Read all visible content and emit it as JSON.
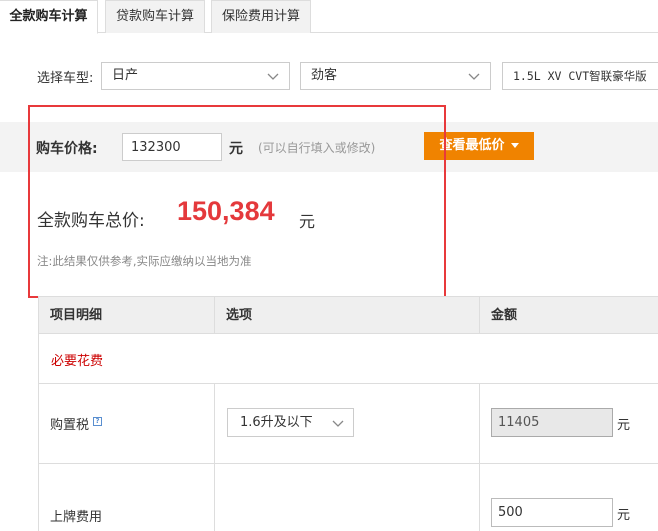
{
  "tabs": [
    {
      "label": "全款购车计算",
      "active": true
    },
    {
      "label": "贷款购车计算",
      "active": false
    },
    {
      "label": "保险费用计算",
      "active": false
    }
  ],
  "car_select": {
    "label": "选择车型:",
    "brand": "日产",
    "series": "劲客",
    "model": "1.5L XV CVT智联豪华版"
  },
  "price": {
    "label": "购车价格:",
    "value": "132300",
    "unit": "元",
    "hint": "(可以自行填入或修改)",
    "lowest_button": "查看最低价"
  },
  "total": {
    "label": "全款购车总价:",
    "value": "150,384",
    "unit": "元",
    "note": "注:此结果仅供参考,实际应缴纳以当地为准"
  },
  "table": {
    "headers": [
      "项目明细",
      "选项",
      "金额"
    ],
    "section_title": "必要花费",
    "rows": [
      {
        "label": "购置税",
        "option": "1.6升及以下",
        "amount": "11405",
        "unit": "元"
      },
      {
        "label": "上牌费用",
        "amount": "500",
        "unit": "元"
      }
    ]
  },
  "colors": {
    "accent_orange": "#f08300",
    "total_red": "#e4393c",
    "annotation_red": "#e8393b"
  }
}
